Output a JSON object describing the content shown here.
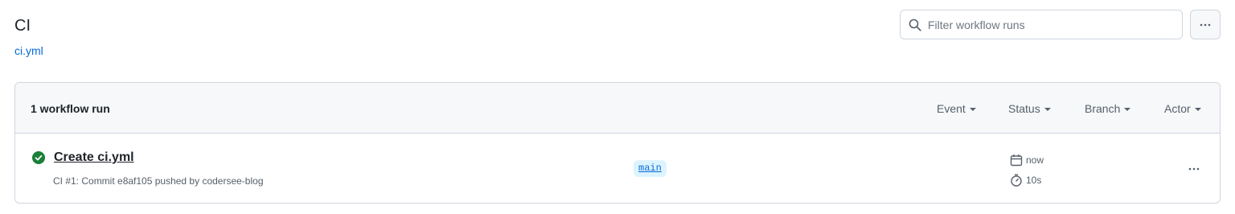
{
  "workflow": {
    "name": "CI",
    "file": "ci.yml"
  },
  "filter": {
    "placeholder": "Filter workflow runs"
  },
  "runs_list": {
    "count_label": "1 workflow run",
    "filters": {
      "event": "Event",
      "status": "Status",
      "branch": "Branch",
      "actor": "Actor"
    },
    "runs": [
      {
        "title": "Create ci.yml",
        "meta": "CI #1: Commit e8af105 pushed by codersee-blog",
        "branch": "main",
        "when": "now",
        "duration": "10s",
        "status": "success"
      }
    ]
  },
  "colors": {
    "success": "#1a7f37",
    "link": "#0969da",
    "border": "#d0d7de",
    "header_bg": "#f6f8fa"
  },
  "icons": [
    "search-icon",
    "kebab-horizontal-icon",
    "check-circle-fill-icon",
    "calendar-icon",
    "stopwatch-icon"
  ]
}
